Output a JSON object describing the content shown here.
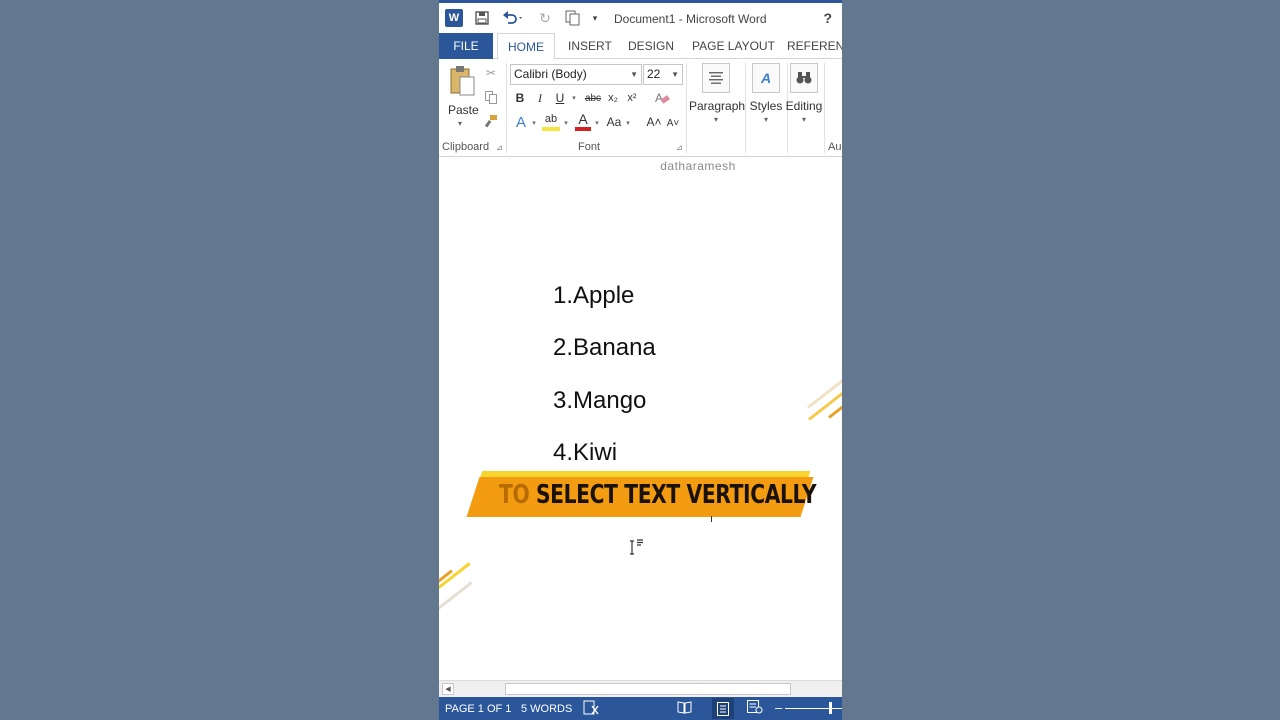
{
  "window": {
    "title": "Document1 - Microsoft Word",
    "help": "?"
  },
  "tabs": [
    {
      "label": "FILE"
    },
    {
      "label": "HOME"
    },
    {
      "label": "INSERT"
    },
    {
      "label": "DESIGN"
    },
    {
      "label": "PAGE LAYOUT"
    },
    {
      "label": "REFERENCES"
    }
  ],
  "ribbon": {
    "clipboard": {
      "paste_label": "Paste",
      "group_label": "Clipboard"
    },
    "font": {
      "font_name": "Calibri (Body)",
      "font_size": "22",
      "group_label": "Font",
      "bold": "B",
      "italic": "I",
      "underline": "U",
      "strike": "abc",
      "subscript": "x₂",
      "superscript": "x²",
      "text_effects": "A",
      "highlight": "ab",
      "font_color": "A",
      "change_case": "Aa",
      "grow": "A˄",
      "shrink": "A˅"
    },
    "paragraph": {
      "label": "Paragraph"
    },
    "styles": {
      "label": "Styles"
    },
    "editing": {
      "label": "Editing"
    },
    "partial_group_label": "Au"
  },
  "watermark": "datharamesh",
  "document": {
    "items": [
      "1.Apple",
      "2.Banana",
      "3.Mango",
      "4.Kiwi"
    ]
  },
  "banner": {
    "faded_prefix": "TO",
    "text": " SELECT TEXT VERTICALLY"
  },
  "status": {
    "page": "PAGE 1 OF 1",
    "words": "5 WORDS"
  },
  "colors": {
    "accent": "#2b579a",
    "banner_orange": "#f39c12",
    "banner_yellow": "#f6d32d",
    "background": "#63778f"
  }
}
